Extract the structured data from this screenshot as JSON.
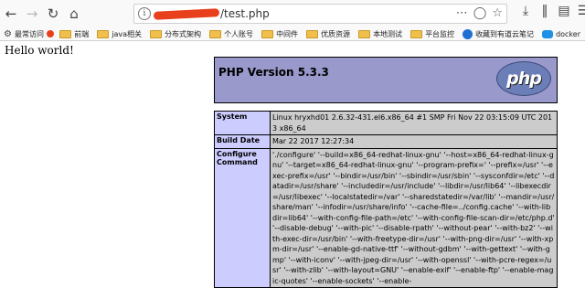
{
  "browser": {
    "nav_icons": {
      "back": "back-arrow-icon",
      "forward": "forward-arrow-icon",
      "reload": "reload-icon",
      "home": "home-icon"
    },
    "url": {
      "visible_text": "/test.php"
    },
    "url_actions": [
      "more-icon",
      "pocket-icon",
      "star-icon"
    ],
    "right_icons": [
      "download-icon",
      "library-icon",
      "sidebar-icon",
      "menu-icon"
    ]
  },
  "bookmarks": [
    {
      "icon": "gear-icon",
      "label": "最常访问"
    },
    {
      "icon": "folder-icon",
      "label": "前端"
    },
    {
      "icon": "folder-icon",
      "label": "java相关"
    },
    {
      "icon": "folder-icon",
      "label": "分布式架构"
    },
    {
      "icon": "folder-icon",
      "label": "个人账号"
    },
    {
      "icon": "folder-icon",
      "label": "中间件"
    },
    {
      "icon": "folder-icon",
      "label": "优质资源"
    },
    {
      "icon": "folder-icon",
      "label": "本地测试"
    },
    {
      "icon": "folder-icon",
      "label": "平台监控"
    },
    {
      "icon": "youdao-icon",
      "label": "收藏到有道云笔记"
    },
    {
      "icon": "docker-icon",
      "label": "docker"
    }
  ],
  "page": {
    "hello": "Hello world!",
    "php_title": "PHP Version 5.3.3",
    "php_logo_text": "php",
    "rows": [
      {
        "key": "System",
        "value": "Linux hryxhd01 2.6.32-431.el6.x86_64 #1 SMP Fri Nov 22 03:15:09 UTC 2013 x86_64"
      },
      {
        "key": "Build Date",
        "value": "Mar 22 2017 12:27:34"
      },
      {
        "key": "Configure Command",
        "value": "'./configure' '--build=x86_64-redhat-linux-gnu' '--host=x86_64-redhat-linux-gnu' '--target=x86_64-redhat-linux-gnu' '--program-prefix=' '--prefix=/usr' '--exec-prefix=/usr' '--bindir=/usr/bin' '--sbindir=/usr/sbin' '--sysconfdir=/etc' '--datadir=/usr/share' '--includedir=/usr/include' '--libdir=/usr/lib64' '--libexecdir=/usr/libexec' '--localstatedir=/var' '--sharedstatedir=/var/lib' '--mandir=/usr/share/man' '--infodir=/usr/share/info' '--cache-file=../config.cache' '--with-libdir=lib64' '--with-config-file-path=/etc' '--with-config-file-scan-dir=/etc/php.d' '--disable-debug' '--with-pic' '--disable-rpath' '--without-pear' '--with-bz2' '--with-exec-dir=/usr/bin' '--with-freetype-dir=/usr' '--with-png-dir=/usr' '--with-xpm-dir=/usr' '--enable-gd-native-ttf' '--without-gdbm' '--with-gettext' '--with-gmp' '--with-iconv' '--with-jpeg-dir=/usr' '--with-openssl' '--with-pcre-regex=/usr' '--with-zlib' '--with-layout=GNU' '--enable-exif' '--enable-ftp' '--enable-magic-quotes' '--enable-sockets' '--enable-"
      }
    ]
  },
  "colors": {
    "php_header": "#9999cc",
    "key_cell": "#ccccff",
    "value_cell": "#cccccc",
    "redaction": "#e8401c"
  }
}
